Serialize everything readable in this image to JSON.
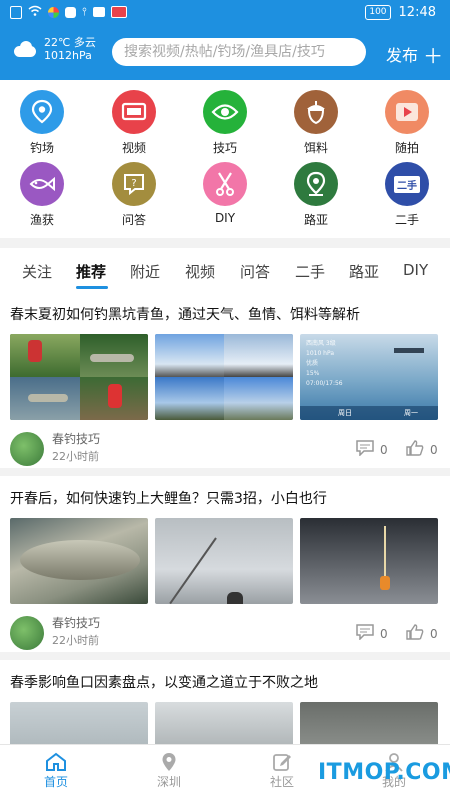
{
  "status": {
    "battery": "100",
    "time": "12:48"
  },
  "header": {
    "temp_cond": "22℃ 多云",
    "pressure": "1012hPa",
    "search_placeholder": "搜索视频/热帖/钓场/渔具店/技巧",
    "publish_label": "发布"
  },
  "categories": [
    {
      "label": "钓场",
      "color": "#2e9be8",
      "icon": "location-pin-icon"
    },
    {
      "label": "视频",
      "color": "#e8424a",
      "icon": "tv-icon"
    },
    {
      "label": "技巧",
      "color": "#25b23a",
      "icon": "eye-icon"
    },
    {
      "label": "饵料",
      "color": "#a0623a",
      "icon": "acorn-icon"
    },
    {
      "label": "随拍",
      "color": "#f08a64",
      "icon": "play-icon"
    },
    {
      "label": "渔获",
      "color": "#9a58c2",
      "icon": "fish-icon"
    },
    {
      "label": "问答",
      "color": "#a38d3e",
      "icon": "question-icon"
    },
    {
      "label": "DIY",
      "color": "#f276a8",
      "icon": "scissors-icon"
    },
    {
      "label": "路亚",
      "color": "#2e7a3e",
      "icon": "map-pin-icon"
    },
    {
      "label": "二手",
      "color": "#2f4ea8",
      "icon": "secondhand-icon",
      "badge": "二手"
    }
  ],
  "tabs": [
    "关注",
    "推荐",
    "附近",
    "视频",
    "问答",
    "二手",
    "路亚",
    "DIY"
  ],
  "posts": [
    {
      "title": "春末夏初如何钓黑坑青鱼，通过天气、鱼情、饵料等解析",
      "author": "春钓技巧",
      "time": "22小时前",
      "comments": "0",
      "likes": "0",
      "screen": {
        "header": "西南风 3级",
        "pressure": "1010 hPa",
        "quality": "优质",
        "humidity": "15%",
        "clock": "07:00/17:56",
        "day1": "周日",
        "day2": "周一"
      }
    },
    {
      "title": "开春后，如何快速钓上大鲤鱼？只需3招，小白也行",
      "author": "春钓技巧",
      "time": "22小时前",
      "comments": "0",
      "likes": "0"
    },
    {
      "title": "春季影响鱼口因素盘点，以变通之道立于不败之地"
    }
  ],
  "nav": [
    "首页",
    "深圳",
    "社区",
    "我的"
  ],
  "watermark": "ITMOP.COM"
}
